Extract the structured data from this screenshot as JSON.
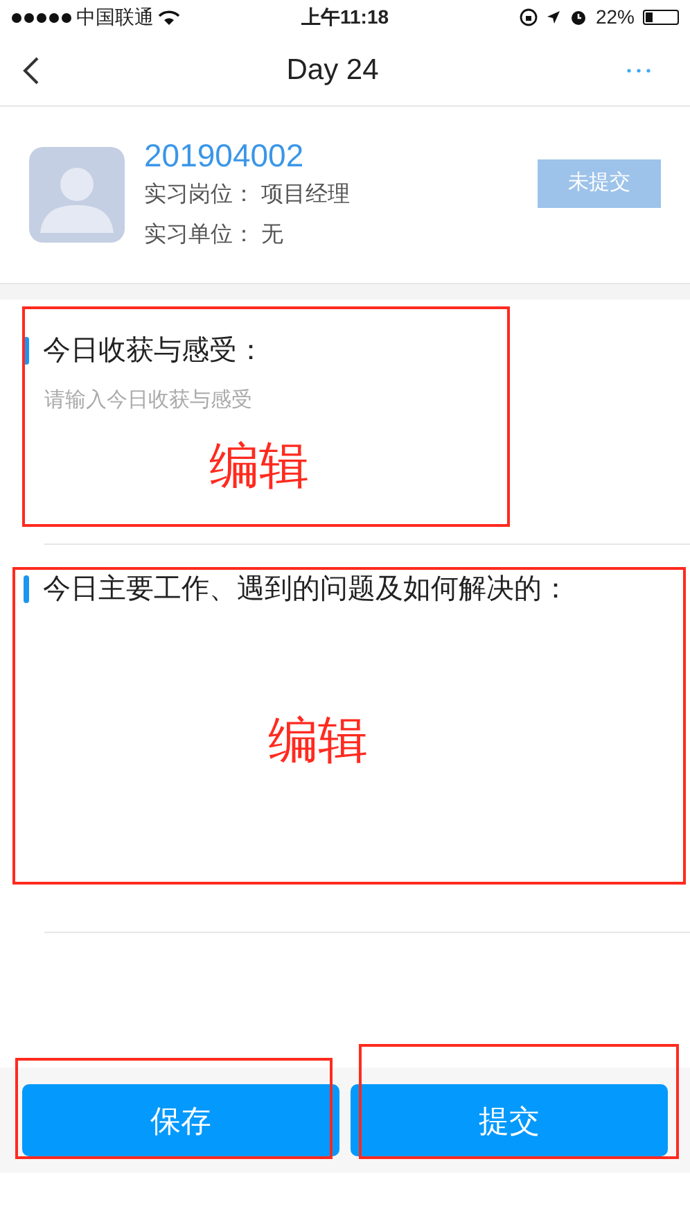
{
  "status_bar": {
    "carrier": "中国联通",
    "time": "上午11:18",
    "battery": "22%"
  },
  "nav": {
    "title": "Day 24"
  },
  "profile": {
    "id": "201904002",
    "fields": [
      {
        "label": "实习岗位：",
        "value": "项目经理"
      },
      {
        "label": "实习单位：",
        "value": "无"
      }
    ],
    "status_badge": "未提交"
  },
  "sections": [
    {
      "title": "今日收获与感受：",
      "placeholder": "请输入今日收获与感受"
    },
    {
      "title": "今日主要工作、遇到的问题及如何解决的："
    }
  ],
  "buttons": [
    {
      "label": "保存"
    },
    {
      "label": "提交"
    }
  ],
  "annotations": [
    {
      "kind": "labeled_box",
      "label": "编辑"
    },
    {
      "kind": "labeled_box",
      "label": "编辑"
    },
    {
      "kind": "box"
    },
    {
      "kind": "box"
    }
  ]
}
